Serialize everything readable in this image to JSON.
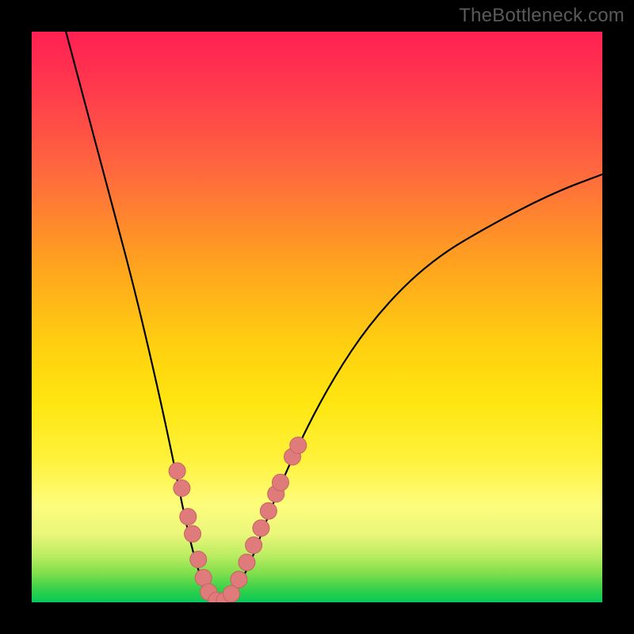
{
  "watermark": "TheBottleneck.com",
  "colors": {
    "frame": "#000000",
    "marker_fill": "#df7b7b",
    "marker_stroke": "#c66262",
    "curve_stroke": "#000000",
    "gradient_stops": [
      "#ff2052",
      "#ff3a4d",
      "#ff6a3d",
      "#ffa020",
      "#ffd010",
      "#ffe610",
      "#fff23c",
      "#fdfd7d",
      "#eaf77a",
      "#b8ec60",
      "#7ede4c",
      "#2fd04a",
      "#08c85a"
    ]
  },
  "chart_data": {
    "type": "line",
    "title": "",
    "xlabel": "",
    "ylabel": "",
    "x_range": [
      0,
      100
    ],
    "y_range": [
      0,
      100
    ],
    "note": "Axes are unlabeled percentage-style. Curve is a V-shaped bottleneck profile with minimum near x≈32. Left arm is steep, right arm is shallower. Values estimated from pixels.",
    "series": [
      {
        "name": "bottleneck-curve",
        "points": [
          {
            "x": 6,
            "y": 100
          },
          {
            "x": 10,
            "y": 85
          },
          {
            "x": 14,
            "y": 70
          },
          {
            "x": 18,
            "y": 55
          },
          {
            "x": 22,
            "y": 38
          },
          {
            "x": 25,
            "y": 24
          },
          {
            "x": 27,
            "y": 14
          },
          {
            "x": 29,
            "y": 6
          },
          {
            "x": 31,
            "y": 1
          },
          {
            "x": 33,
            "y": 0
          },
          {
            "x": 35,
            "y": 1
          },
          {
            "x": 38,
            "y": 6
          },
          {
            "x": 41,
            "y": 14
          },
          {
            "x": 45,
            "y": 24
          },
          {
            "x": 52,
            "y": 38
          },
          {
            "x": 60,
            "y": 50
          },
          {
            "x": 70,
            "y": 60
          },
          {
            "x": 82,
            "y": 67
          },
          {
            "x": 92,
            "y": 72
          },
          {
            "x": 100,
            "y": 75
          }
        ]
      }
    ],
    "markers": {
      "name": "highlighted-points",
      "points": [
        {
          "x": 25.5,
          "y": 23
        },
        {
          "x": 26.3,
          "y": 20
        },
        {
          "x": 27.4,
          "y": 15
        },
        {
          "x": 28.2,
          "y": 12
        },
        {
          "x": 29.2,
          "y": 7.5
        },
        {
          "x": 30.1,
          "y": 4.3
        },
        {
          "x": 31.0,
          "y": 1.8
        },
        {
          "x": 32.4,
          "y": 0.3
        },
        {
          "x": 33.8,
          "y": 0.3
        },
        {
          "x": 35.0,
          "y": 1.5
        },
        {
          "x": 36.3,
          "y": 4
        },
        {
          "x": 37.7,
          "y": 7
        },
        {
          "x": 38.9,
          "y": 10
        },
        {
          "x": 40.2,
          "y": 13
        },
        {
          "x": 41.5,
          "y": 16
        },
        {
          "x": 42.8,
          "y": 19
        },
        {
          "x": 43.6,
          "y": 21
        },
        {
          "x": 45.7,
          "y": 25.5
        },
        {
          "x": 46.7,
          "y": 27.5
        }
      ]
    }
  }
}
